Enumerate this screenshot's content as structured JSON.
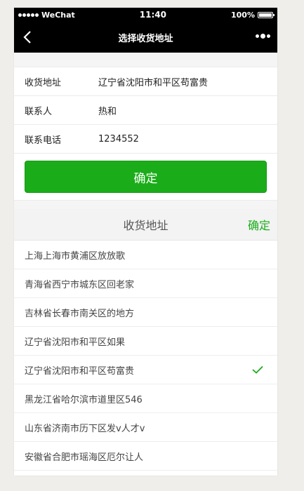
{
  "status_bar": {
    "carrier": "WeChat",
    "time": "11:40",
    "battery": "100%"
  },
  "nav": {
    "title": "选择收货地址",
    "back_icon": "chevron-left-icon",
    "more_icon": "more-dots-icon"
  },
  "form": {
    "rows": [
      {
        "label": "收货地址",
        "value": "辽宁省沈阳市和平区苟富贵"
      },
      {
        "label": "联系人",
        "value": "热和"
      },
      {
        "label": "联系电话",
        "value": "1234552"
      }
    ],
    "confirm_label": "确定"
  },
  "address_list": {
    "header_title": "收货地址",
    "header_confirm": "确定",
    "items": [
      {
        "text": "上海上海市黄浦区放放歌",
        "selected": false
      },
      {
        "text": "青海省西宁市城东区回老家",
        "selected": false
      },
      {
        "text": "吉林省长春市南关区的地方",
        "selected": false
      },
      {
        "text": "辽宁省沈阳市和平区如果",
        "selected": false
      },
      {
        "text": "辽宁省沈阳市和平区苟富贵",
        "selected": true
      },
      {
        "text": "黑龙江省哈尔滨市道里区546",
        "selected": false
      },
      {
        "text": "山东省济南市历下区发v人才v",
        "selected": false
      },
      {
        "text": "安徽省合肥市瑶海区厄尔让人",
        "selected": false
      }
    ]
  },
  "colors": {
    "accent": "#1aad19",
    "nav_bg": "#000000"
  }
}
